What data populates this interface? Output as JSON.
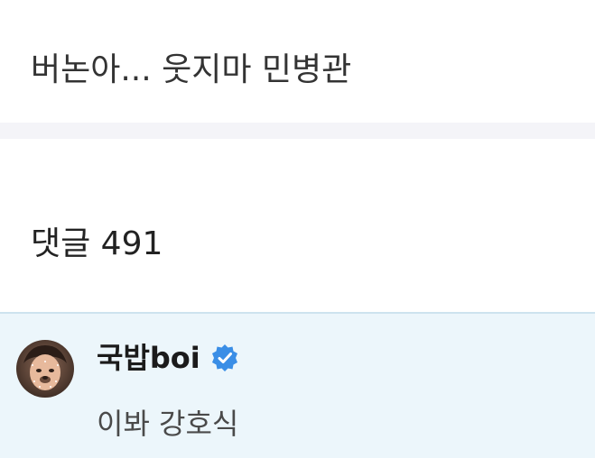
{
  "post": {
    "title": "버논아... 웃지마 민병관"
  },
  "comments": {
    "header": "댓글 491",
    "items": [
      {
        "author": "국밥boi",
        "verified": true,
        "text": "이봐 강호식",
        "avatar_icon": "user-avatar"
      }
    ]
  },
  "colors": {
    "highlight_background": "#ecf6fb",
    "verified_badge": "#3a8ee6",
    "divider": "#f4f4f8"
  }
}
